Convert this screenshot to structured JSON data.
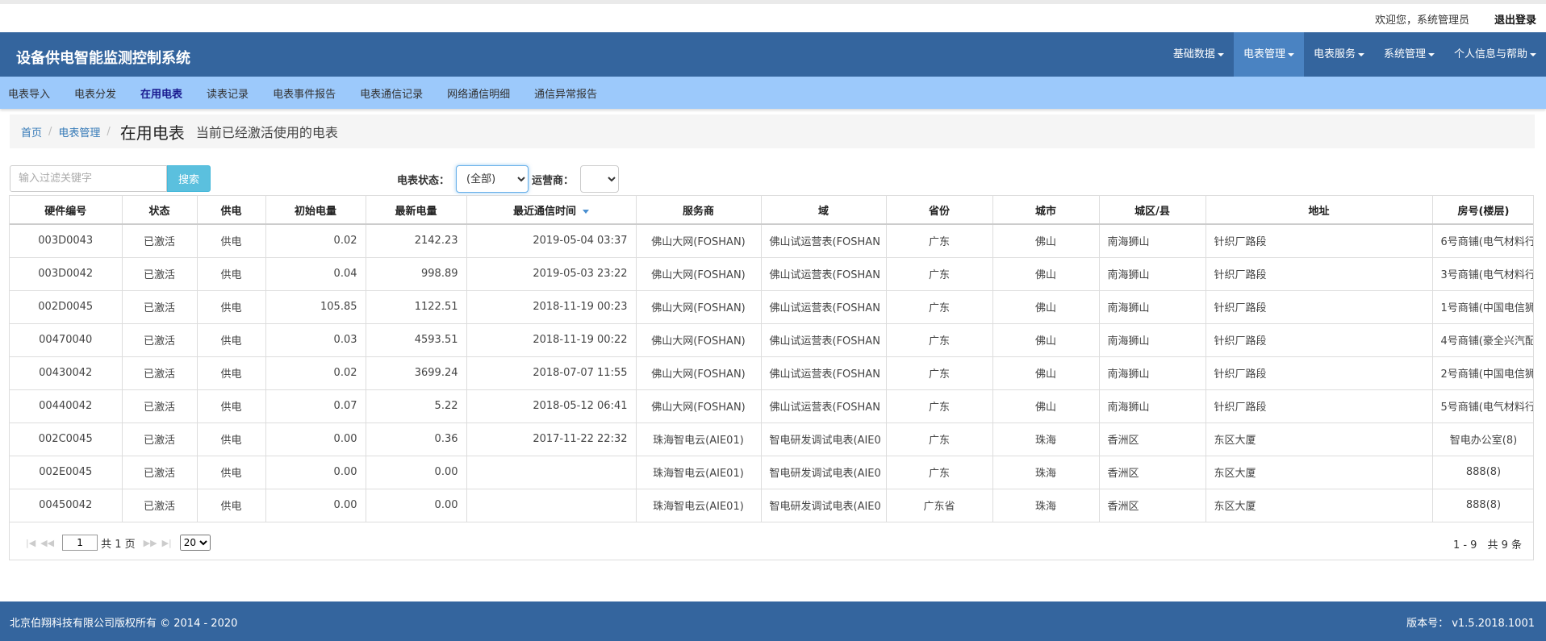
{
  "top": {
    "welcome": "欢迎您，系统管理员",
    "logout": "退出登录"
  },
  "brand": "设备供电智能监测控制系统",
  "nav": [
    {
      "label": "基础数据"
    },
    {
      "label": "电表管理"
    },
    {
      "label": "电表服务"
    },
    {
      "label": "系统管理"
    },
    {
      "label": "个人信息与帮助"
    }
  ],
  "subnav": [
    "电表导入",
    "电表分发",
    "在用电表",
    "读表记录",
    "电表事件报告",
    "电表通信记录",
    "网络通信明细",
    "通信异常报告"
  ],
  "breadcrumb": {
    "home": "首页",
    "section": "电表管理",
    "sep": "/",
    "title": "在用电表",
    "subtitle": "当前已经激活使用的电表"
  },
  "filter": {
    "placeholder": "输入过滤关键字",
    "search_label": "搜索",
    "status_label": "电表状态：",
    "status_value": "(全部)",
    "operator_label": "运营商："
  },
  "table": {
    "headers": [
      "硬件编号",
      "状态",
      "供电",
      "初始电量",
      "最新电量",
      "最近通信时间",
      "服务商",
      "域",
      "省份",
      "城市",
      "城区/县",
      "地址",
      "房号(楼层)"
    ],
    "rows": [
      [
        "003D0043",
        "已激活",
        "供电",
        "0.02",
        "2142.23",
        "2019-05-04 03:37",
        "佛山大网(FOSHAN)",
        "佛山试运营表(FOSHAN",
        "广东",
        "佛山",
        "南海狮山",
        "针织厂路段",
        "6号商铺(电气材料行"
      ],
      [
        "003D0042",
        "已激活",
        "供电",
        "0.04",
        "998.89",
        "2019-05-03 23:22",
        "佛山大网(FOSHAN)",
        "佛山试运营表(FOSHAN",
        "广东",
        "佛山",
        "南海狮山",
        "针织厂路段",
        "3号商铺(电气材料行"
      ],
      [
        "002D0045",
        "已激活",
        "供电",
        "105.85",
        "1122.51",
        "2018-11-19 00:23",
        "佛山大网(FOSHAN)",
        "佛山试运营表(FOSHAN",
        "广东",
        "佛山",
        "南海狮山",
        "针织厂路段",
        "1号商铺(中国电信狮"
      ],
      [
        "00470040",
        "已激活",
        "供电",
        "0.03",
        "4593.51",
        "2018-11-19 00:22",
        "佛山大网(FOSHAN)",
        "佛山试运营表(FOSHAN",
        "广东",
        "佛山",
        "南海狮山",
        "针织厂路段",
        "4号商铺(豪全兴汽配"
      ],
      [
        "00430042",
        "已激活",
        "供电",
        "0.02",
        "3699.24",
        "2018-07-07 11:55",
        "佛山大网(FOSHAN)",
        "佛山试运营表(FOSHAN",
        "广东",
        "佛山",
        "南海狮山",
        "针织厂路段",
        "2号商铺(中国电信狮"
      ],
      [
        "00440042",
        "已激活",
        "供电",
        "0.07",
        "5.22",
        "2018-05-12 06:41",
        "佛山大网(FOSHAN)",
        "佛山试运营表(FOSHAN",
        "广东",
        "佛山",
        "南海狮山",
        "针织厂路段",
        "5号商铺(电气材料行"
      ],
      [
        "002C0045",
        "已激活",
        "供电",
        "0.00",
        "0.36",
        "2017-11-22 22:32",
        "珠海智电云(AIE01)",
        "智电研发调试电表(AIE0",
        "广东",
        "珠海",
        "香洲区",
        "东区大厦",
        "智电办公室(8)"
      ],
      [
        "002E0045",
        "已激活",
        "供电",
        "0.00",
        "0.00",
        "",
        "珠海智电云(AIE01)",
        "智电研发调试电表(AIE0",
        "广东",
        "珠海",
        "香洲区",
        "东区大厦",
        "888(8)"
      ],
      [
        "00450042",
        "已激活",
        "供电",
        "0.00",
        "0.00",
        "",
        "珠海智电云(AIE01)",
        "智电研发调试电表(AIE0",
        "广东省",
        "珠海",
        "香洲区",
        "东区大厦",
        "888(8)"
      ]
    ]
  },
  "pager": {
    "page": "1",
    "total_pages": "共 1 页",
    "page_size": "20",
    "info": "1 - 9　共 9 条"
  },
  "footer": {
    "copyright": "北京伯翔科技有限公司版权所有 © 2014 - 2020",
    "version": "版本号： v1.5.2018.1001"
  }
}
